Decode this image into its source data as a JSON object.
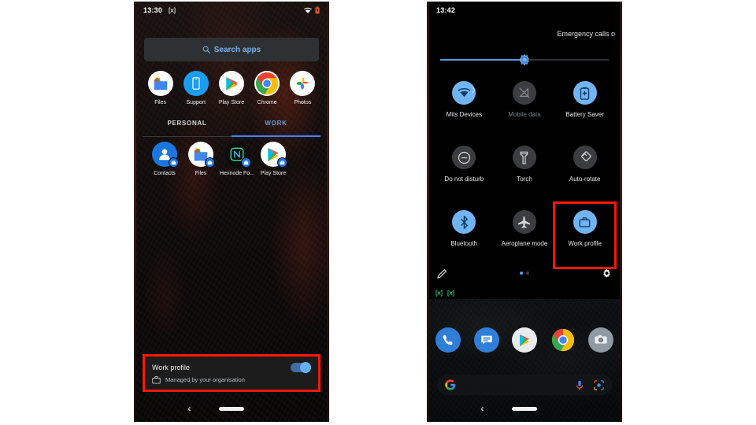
{
  "left_phone": {
    "status_bar": {
      "time": "13:30",
      "notification_icons": [
        "app-notification-icon"
      ],
      "wifi_icon": "wifi-icon",
      "battery_icon": "battery-low-icon"
    },
    "search": {
      "label": "Search apps",
      "icon": "search-icon"
    },
    "personal_apps": [
      {
        "label": "Files",
        "icon": "files-icon"
      },
      {
        "label": "Support",
        "icon": "support-icon"
      },
      {
        "label": "Play Store",
        "icon": "play-store-icon"
      },
      {
        "label": "Chrome",
        "icon": "chrome-icon"
      },
      {
        "label": "Photos",
        "icon": "photos-icon"
      }
    ],
    "tabs": [
      {
        "label": "PERSONAL",
        "active": false
      },
      {
        "label": "WORK",
        "active": true
      }
    ],
    "work_apps": [
      {
        "label": "Contacts",
        "icon": "contacts-icon",
        "badge": "work-badge-icon"
      },
      {
        "label": "Files",
        "icon": "files-icon",
        "badge": "work-badge-icon"
      },
      {
        "label": "Hexnode Fo...",
        "icon": "hexnode-icon",
        "badge": "work-badge-icon"
      },
      {
        "label": "Play Store",
        "icon": "play-store-icon",
        "badge": "work-badge-icon"
      }
    ],
    "work_profile_card": {
      "title": "Work profile",
      "subtitle": "Managed by your organisation",
      "briefcase_icon": "briefcase-icon",
      "toggle_state": "on",
      "highlight_color": "#fd1705"
    },
    "nav": {
      "back_icon": "back-icon",
      "home_pill": "home-pill"
    }
  },
  "right_phone": {
    "status_bar": {
      "time": "13:42"
    },
    "emergency_text": "Emergency calls o",
    "brightness": {
      "value_percent": 50,
      "icon": "brightness-icon"
    },
    "quick_settings": [
      {
        "label": "Mits Devices",
        "icon": "wifi-icon",
        "state": "on",
        "expandable": true
      },
      {
        "label": "Mobile data",
        "icon": "mobile-data-off-icon",
        "state": "off",
        "expandable": false
      },
      {
        "label": "Battery Saver",
        "icon": "battery-saver-icon",
        "state": "on",
        "expandable": false
      },
      {
        "label": "Do not disturb",
        "icon": "do-not-disturb-icon",
        "state": "off",
        "expandable": false
      },
      {
        "label": "Torch",
        "icon": "torch-icon",
        "state": "off",
        "expandable": false
      },
      {
        "label": "Auto-rotate",
        "icon": "auto-rotate-icon",
        "state": "off",
        "expandable": false
      },
      {
        "label": "Bluetooth",
        "icon": "bluetooth-icon",
        "state": "on",
        "expandable": false
      },
      {
        "label": "Aeroplane mode",
        "icon": "aeroplane-mode-icon",
        "state": "off",
        "expandable": false
      },
      {
        "label": "Work profile",
        "icon": "briefcase-icon",
        "state": "on",
        "expandable": false,
        "highlighted": true
      }
    ],
    "footer": {
      "edit_icon": "pencil-icon",
      "settings_icon": "gear-icon",
      "pages": 2,
      "active_page": 1
    },
    "notification_icons": [
      "app-notification-icon",
      "app-notification-icon"
    ],
    "dock_apps": [
      {
        "label": "Phone",
        "icon": "phone-icon"
      },
      {
        "label": "Messages",
        "icon": "messages-icon"
      },
      {
        "label": "Play Store",
        "icon": "play-store-icon"
      },
      {
        "label": "Chrome",
        "icon": "chrome-icon"
      },
      {
        "label": "Camera",
        "icon": "camera-icon"
      }
    ],
    "google_search": {
      "logo": "google-g-icon",
      "mic_icon": "microphone-icon",
      "lens_icon": "google-lens-icon"
    },
    "nav": {
      "back_icon": "back-icon",
      "home_pill": "home-pill"
    }
  }
}
